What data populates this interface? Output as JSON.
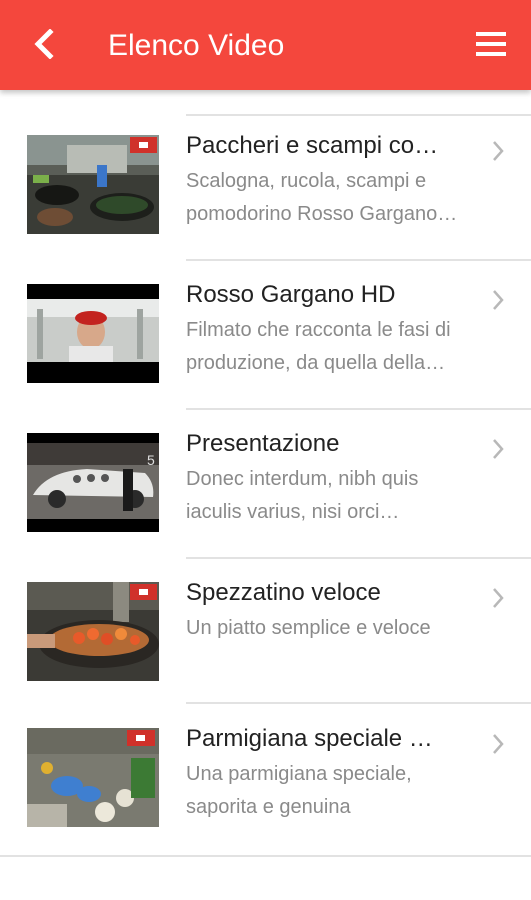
{
  "app_bar": {
    "title": "Elenco Video",
    "back_icon": "chevron-left-icon",
    "menu_icon": "hamburger-menu-icon",
    "color": "#f4473d"
  },
  "videos": [
    {
      "title": "Paccheri e scampi co…",
      "desc_line1": "Scalogna, rucola, scampi e",
      "desc_line2": "pomodorino Rosso Gargano…",
      "thumb": "kitchen-pan-thumbnail"
    },
    {
      "title": "Rosso Gargano HD",
      "desc_line1": "Filmato che racconta le fasi di",
      "desc_line2": "produzione, da quella della…",
      "thumb": "factory-worker-thumbnail"
    },
    {
      "title": "Presentazione",
      "desc_line1": "Donec interdum, nibh quis",
      "desc_line2": "iaculis varius, nisi orci…",
      "thumb": "car-showroom-thumbnail"
    },
    {
      "title": "Spezzatino veloce",
      "desc_line1": "Un piatto semplice e veloce",
      "desc_line2": "",
      "thumb": "tomato-pan-thumbnail"
    },
    {
      "title": "Parmigiana speciale …",
      "desc_line1": "Una parmigiana speciale,",
      "desc_line2": "saporita e genuina",
      "thumb": "cooking-hands-thumbnail"
    }
  ]
}
